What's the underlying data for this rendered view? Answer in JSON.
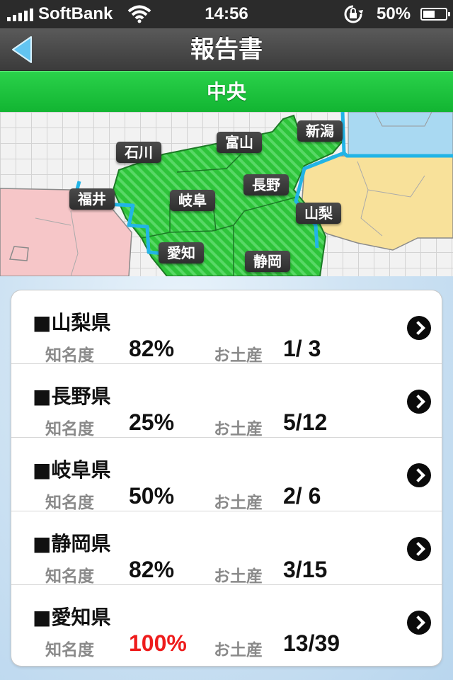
{
  "status_bar": {
    "carrier": "SoftBank",
    "time": "14:56",
    "battery": "50%",
    "icons": [
      "signal-icon",
      "wifi-icon",
      "rotation-lock-icon",
      "battery-charging-icon"
    ]
  },
  "nav": {
    "title": "報告書",
    "back_icon": "back-arrow-icon"
  },
  "region": {
    "title": "中央"
  },
  "map": {
    "labels": [
      "石川",
      "富山",
      "新潟",
      "福井",
      "岐阜",
      "長野",
      "山梨",
      "愛知",
      "静岡"
    ],
    "colors": {
      "selected": "#2ec43a",
      "neighbor_west": "#f6c6c8",
      "neighbor_east": "#f8e19a",
      "neighbor_north": "#a9d9f2",
      "border_line": "#22b4e6"
    }
  },
  "list": {
    "fame_label": "知名度",
    "souvenir_label": "お土産",
    "items": [
      {
        "name": "■山梨県",
        "fame": "82%",
        "souvenir": "1/ 3"
      },
      {
        "name": "■長野県",
        "fame": "25%",
        "souvenir": "5/12"
      },
      {
        "name": "■岐阜県",
        "fame": "50%",
        "souvenir": "2/ 6"
      },
      {
        "name": "■静岡県",
        "fame": "82%",
        "souvenir": "3/15"
      },
      {
        "name": "■愛知県",
        "fame": "100%",
        "souvenir": "13/39"
      }
    ],
    "colors": {
      "highlight": "#ee1c1c"
    }
  }
}
